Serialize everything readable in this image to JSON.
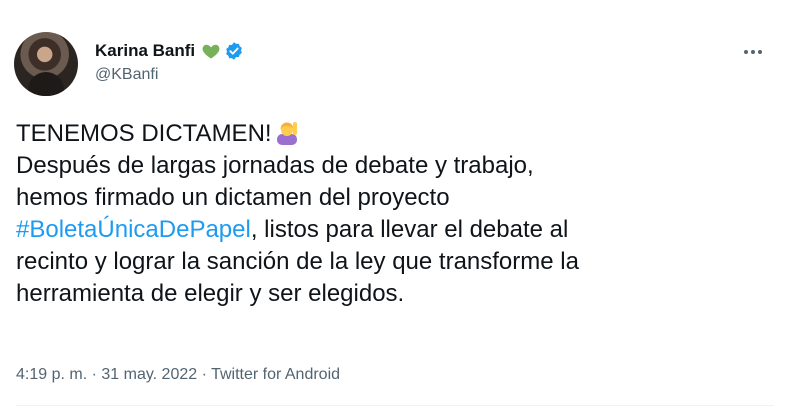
{
  "author": {
    "display_name": "Karina Banfi",
    "handle": "@KBanfi",
    "badge_emoji": "green-heart-icon",
    "verified": true
  },
  "tweet": {
    "line1": "TENEMOS DICTAMEN!",
    "line1_emoji": "person-raising-hand-icon",
    "line2": "Después de largas jornadas de debate y trabajo,",
    "line3": "hemos firmado un dictamen del proyecto",
    "hashtag": "#BoletaÚnicaDePapel",
    "line4_rest": ", listos para llevar el debate al",
    "line5": "recinto y lograr la sanción de la ley que transforme la",
    "line6": "herramienta de elegir y ser elegidos."
  },
  "meta": {
    "time": "4:19 p. m.",
    "sep1": " · ",
    "date": "31 may. 2022",
    "sep2": " · ",
    "source": "Twitter for Android"
  },
  "colors": {
    "link": "#1d9bf0",
    "secondary_text": "#536471",
    "verified_badge": "#1d9bf0",
    "heart": "#78b159"
  }
}
